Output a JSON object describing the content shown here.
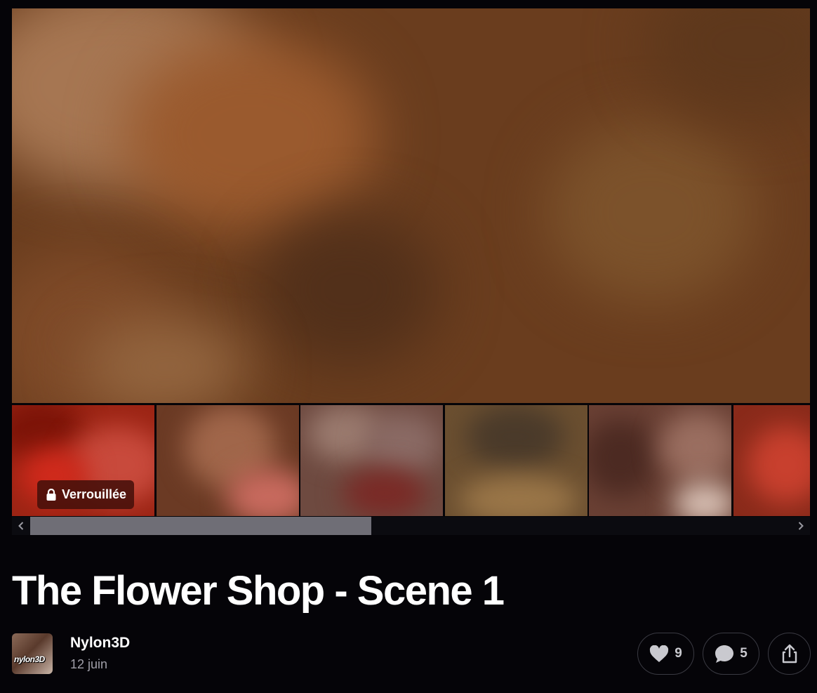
{
  "post": {
    "title": "The Flower Shop - Scene 1",
    "locked_label": "Verrouillée"
  },
  "author": {
    "name": "Nylon3D",
    "date": "12 juin",
    "avatar_text": "nylon3D"
  },
  "actions": {
    "likes": "9",
    "comments": "5"
  },
  "icons": {
    "lock": "lock-icon",
    "like": "heart-icon",
    "comment": "comment-bubble-icon",
    "share": "share-icon",
    "scroll_left": "chevron-left-icon",
    "scroll_right": "chevron-right-icon"
  },
  "colors": {
    "background": "#050408",
    "hero": "#6a3d1e",
    "lock_badge": "#46100a",
    "pill_border": "#3a3a42",
    "muted_text": "#a09fa8"
  }
}
